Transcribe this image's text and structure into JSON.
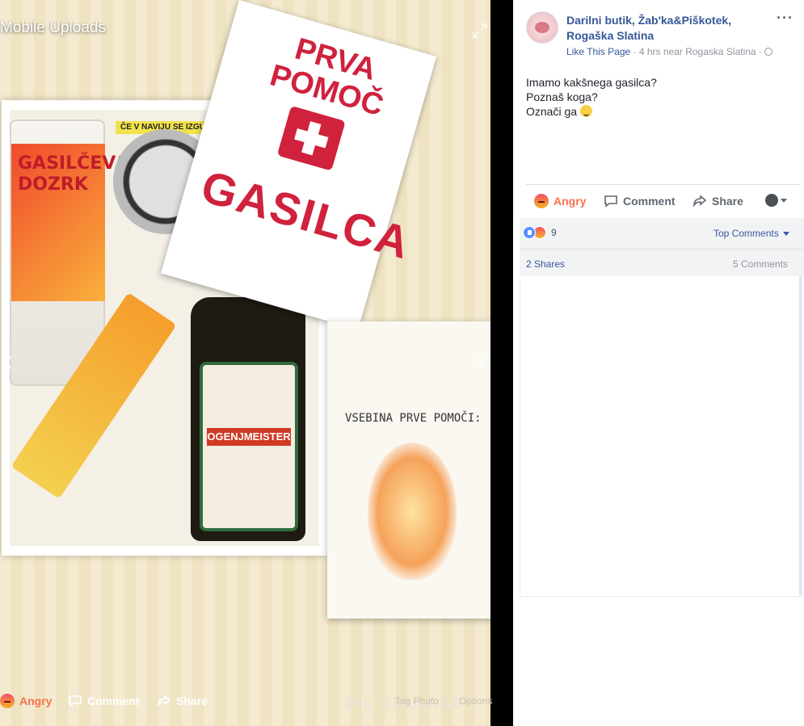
{
  "viewer": {
    "album_title": "Mobile Uploads",
    "bottom_bar": {
      "angry_label": "Angry",
      "comment_label": "Comment",
      "share_label": "Share",
      "tag_photo_label": "Tag Photo",
      "options_label": "Options"
    },
    "photo": {
      "watermark": "PIC·COLLAGE",
      "tag_text": "ČE V NAVIJU SE IZGUBIŠ",
      "glass_text": "GASILČEVA DOZRK",
      "bottle_title": "OGENJMEISTER",
      "card_title": "PRVA POMOČ",
      "card_big_text": "GASILCA",
      "list_title": "VSEBINA PRVE POMOČI:"
    }
  },
  "post": {
    "page_name": "Darilni butik, Žab'ka&Piškotek, Rogaška Slatina",
    "like_link": "Like This Page",
    "meta_text": " · 4 hrs near Rogaska Slatina · ",
    "text_lines": [
      "Imamo kakšnega gasilca?",
      "Poznaš koga?",
      "Označi ga"
    ],
    "actions": {
      "angry_label": "Angry",
      "comment_label": "Comment",
      "share_label": "Share"
    },
    "stats": {
      "reaction_count": "9",
      "top_comments_label": "Top Comments",
      "shares_label": "2 Shares",
      "comments_label": "5 Comments"
    }
  },
  "colors": {
    "link_blue": "#365899",
    "angry_orange": "#f7714c",
    "text_gray": "#606770",
    "meta_gray": "#90949c"
  }
}
